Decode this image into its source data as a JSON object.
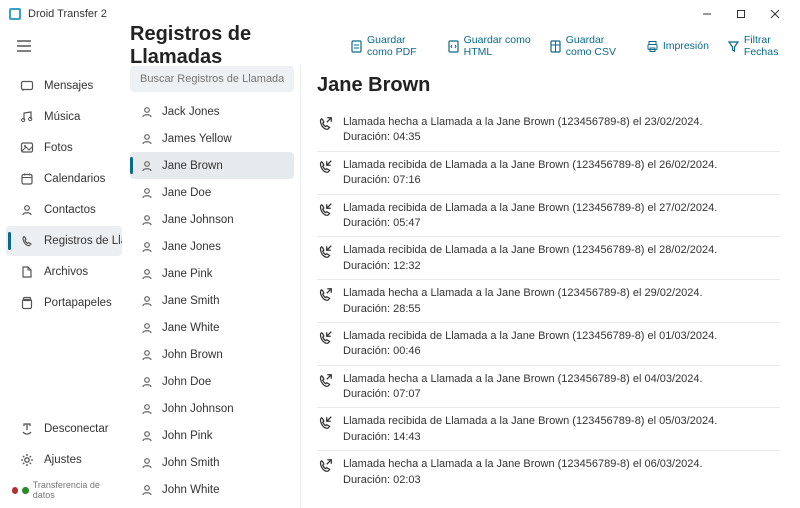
{
  "window": {
    "title": "Droid Transfer 2"
  },
  "hamburger": "≡",
  "page_title": "Registros de Llamadas",
  "toolbar": {
    "pdf": "Guardar como PDF",
    "html": "Guardar como HTML",
    "csv": "Guardar como CSV",
    "print": "Impresión",
    "filter": "Filtrar Fechas"
  },
  "sidebar": {
    "items": [
      {
        "label": "Mensajes"
      },
      {
        "label": "Música"
      },
      {
        "label": "Fotos"
      },
      {
        "label": "Calendarios"
      },
      {
        "label": "Contactos"
      },
      {
        "label": "Registros de Llamadas"
      },
      {
        "label": "Archivos"
      },
      {
        "label": "Portapapeles"
      }
    ],
    "disconnect": "Desconectar",
    "settings": "Ajustes",
    "status": "Transferencia de datos"
  },
  "search": {
    "placeholder": "Buscar Registros de Llamadas"
  },
  "contacts": [
    "Jack Jones",
    "James Yellow",
    "Jane Brown",
    "Jane Doe",
    "Jane Johnson",
    "Jane Jones",
    "Jane Pink",
    "Jane Smith",
    "Jane White",
    "John Brown",
    "John Doe",
    "John Johnson",
    "John Pink",
    "John Smith",
    "John White"
  ],
  "selected_contact_index": 2,
  "detail": {
    "title": "Jane Brown",
    "calls": [
      {
        "dir": "out",
        "line1": "Llamada hecha a Llamada a la Jane Brown (123456789-8) el 23/02/2024.",
        "line2": "Duración: 04:35"
      },
      {
        "dir": "in",
        "line1": "Llamada recibida de Llamada a la Jane Brown (123456789-8) el 26/02/2024.",
        "line2": "Duración: 07:16"
      },
      {
        "dir": "in",
        "line1": "Llamada recibida de Llamada a la Jane Brown (123456789-8) el 27/02/2024.",
        "line2": "Duración: 05:47"
      },
      {
        "dir": "in",
        "line1": "Llamada recibida de Llamada a la Jane Brown (123456789-8) el 28/02/2024.",
        "line2": "Duración: 12:32"
      },
      {
        "dir": "out",
        "line1": "Llamada hecha a Llamada a la Jane Brown (123456789-8) el 29/02/2024.",
        "line2": "Duración: 28:55"
      },
      {
        "dir": "in",
        "line1": "Llamada recibida de Llamada a la Jane Brown (123456789-8) el 01/03/2024.",
        "line2": "Duración: 00:46"
      },
      {
        "dir": "out",
        "line1": "Llamada hecha a Llamada a la Jane Brown (123456789-8) el 04/03/2024.",
        "line2": "Duración: 07:07"
      },
      {
        "dir": "in",
        "line1": "Llamada recibida de Llamada a la Jane Brown (123456789-8) el 05/03/2024.",
        "line2": "Duración: 14:43"
      },
      {
        "dir": "out",
        "line1": "Llamada hecha a Llamada a la Jane Brown (123456789-8) el 06/03/2024.",
        "line2": "Duración: 02:03"
      }
    ]
  }
}
